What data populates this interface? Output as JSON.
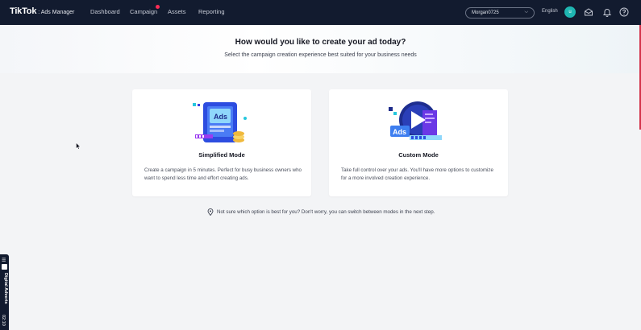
{
  "header": {
    "logo_main": "TikTok",
    "logo_sub": ": Ads Manager",
    "nav": {
      "dashboard": "Dashboard",
      "campaign": "Campaign",
      "assets": "Assets",
      "reporting": "Reporting"
    },
    "account": "Morgan0725",
    "language": "English",
    "avatar_initial": "u"
  },
  "hero": {
    "title": "How would you like to create your ad today?",
    "subtitle": "Select the campaign creation experience best suited for your business needs"
  },
  "cards": {
    "simplified": {
      "title": "Simplified Mode",
      "description": "Create a campaign in 5 minutes. Perfect for busy business owners who want to spend less time and effort creating ads.",
      "badge": "Ads"
    },
    "custom": {
      "title": "Custom Mode",
      "description": "Take full control over your ads. You'll have more options to customize for a more involved creation experience.",
      "badge": "Ads"
    }
  },
  "hint": "Not sure which option is best for you? Don't worry, you can switch between modes in the next step.",
  "sidetab": {
    "menu_glyph": "☰",
    "label": "Digital Adverts",
    "time": "02:10"
  },
  "colors": {
    "topbar": "#121b2f",
    "accent": "#fe2c55",
    "avatar": "#1fb6b2",
    "page_bg": "#f3f4f6"
  }
}
